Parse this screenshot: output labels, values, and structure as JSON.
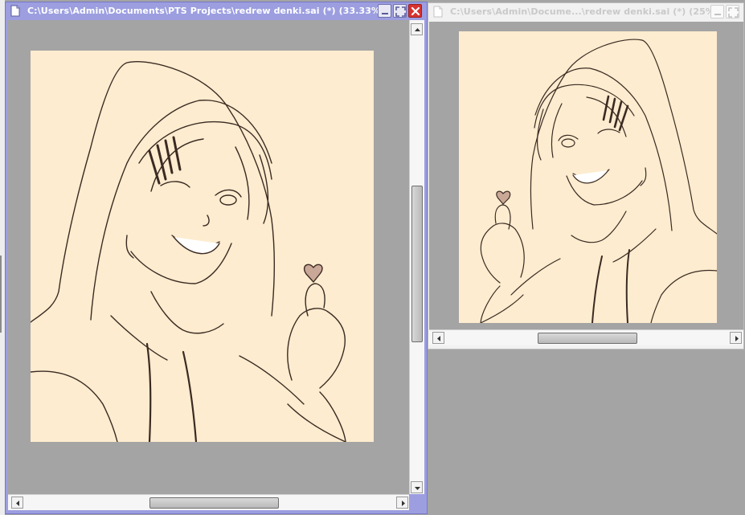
{
  "windows": [
    {
      "id": "main",
      "title": "C:\\Users\\Admin\\Documents\\PTS Projects\\redrew denki.sai (*) (33.33%)",
      "state": "active"
    },
    {
      "id": "secondary",
      "title": "C:\\Users\\Admin\\Docume...\\redrew denki.sai (*) (25%)",
      "state": "inactive"
    }
  ],
  "icons": {
    "doc": "document-icon",
    "minimize": "minimize-icon",
    "maximize": "maximize-icon",
    "close": "close-icon",
    "arrow_up": "arrow-up-icon",
    "arrow_down": "arrow-down-icon",
    "arrow_left": "arrow-left-icon",
    "arrow_right": "arrow-right-icon"
  },
  "colors": {
    "active_titlebar": "#9c9ee0",
    "close_button": "#d8322f",
    "workspace": "#a4a4a4",
    "canvas_paper": "#fdeccf",
    "line_art": "#3b2a22"
  }
}
